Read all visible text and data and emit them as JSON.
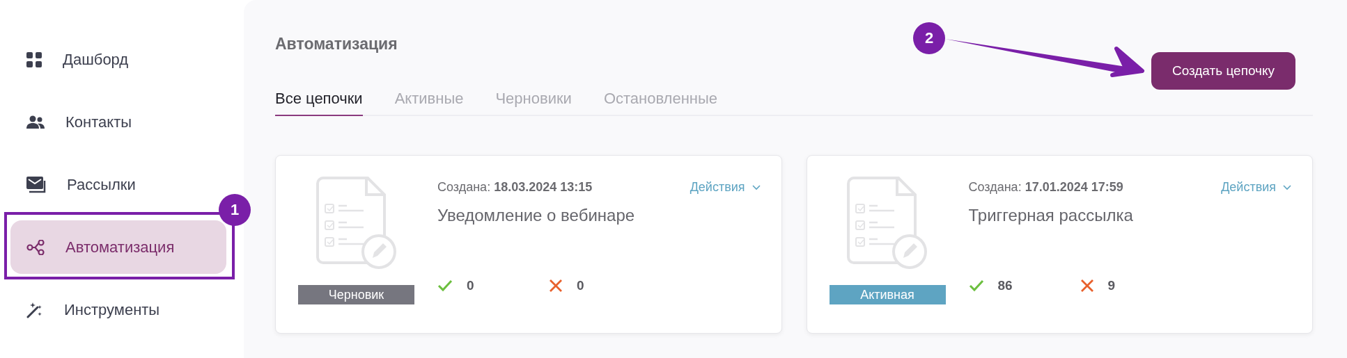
{
  "sidebar": {
    "items": [
      {
        "label": "Дашборд",
        "selected": false
      },
      {
        "label": "Контакты",
        "selected": false
      },
      {
        "label": "Рассылки",
        "selected": false
      },
      {
        "label": "Автоматизация",
        "selected": true
      },
      {
        "label": "Инструменты",
        "selected": false
      }
    ]
  },
  "page": {
    "title": "Автоматизация",
    "create_button": "Создать цепочку"
  },
  "tabs": [
    {
      "label": "Все цепочки",
      "selected": true
    },
    {
      "label": "Активные",
      "selected": false
    },
    {
      "label": "Черновики",
      "selected": false
    },
    {
      "label": "Остановленные",
      "selected": false
    }
  ],
  "cards": [
    {
      "created_label": "Создана:",
      "created": "18.03.2024 13:15",
      "actions": "Действия",
      "name": "Уведомление о вебинаре",
      "status": {
        "label": "Черновик",
        "kind": "draft"
      },
      "delivered": "0",
      "failed": "0"
    },
    {
      "created_label": "Создана:",
      "created": "17.01.2024 17:59",
      "actions": "Действия",
      "name": "Триггерная рассылка",
      "status": {
        "label": "Активная",
        "kind": "active"
      },
      "delivered": "86",
      "failed": "9"
    }
  ],
  "annotations": [
    {
      "label": "1"
    },
    {
      "label": "2"
    }
  ]
}
